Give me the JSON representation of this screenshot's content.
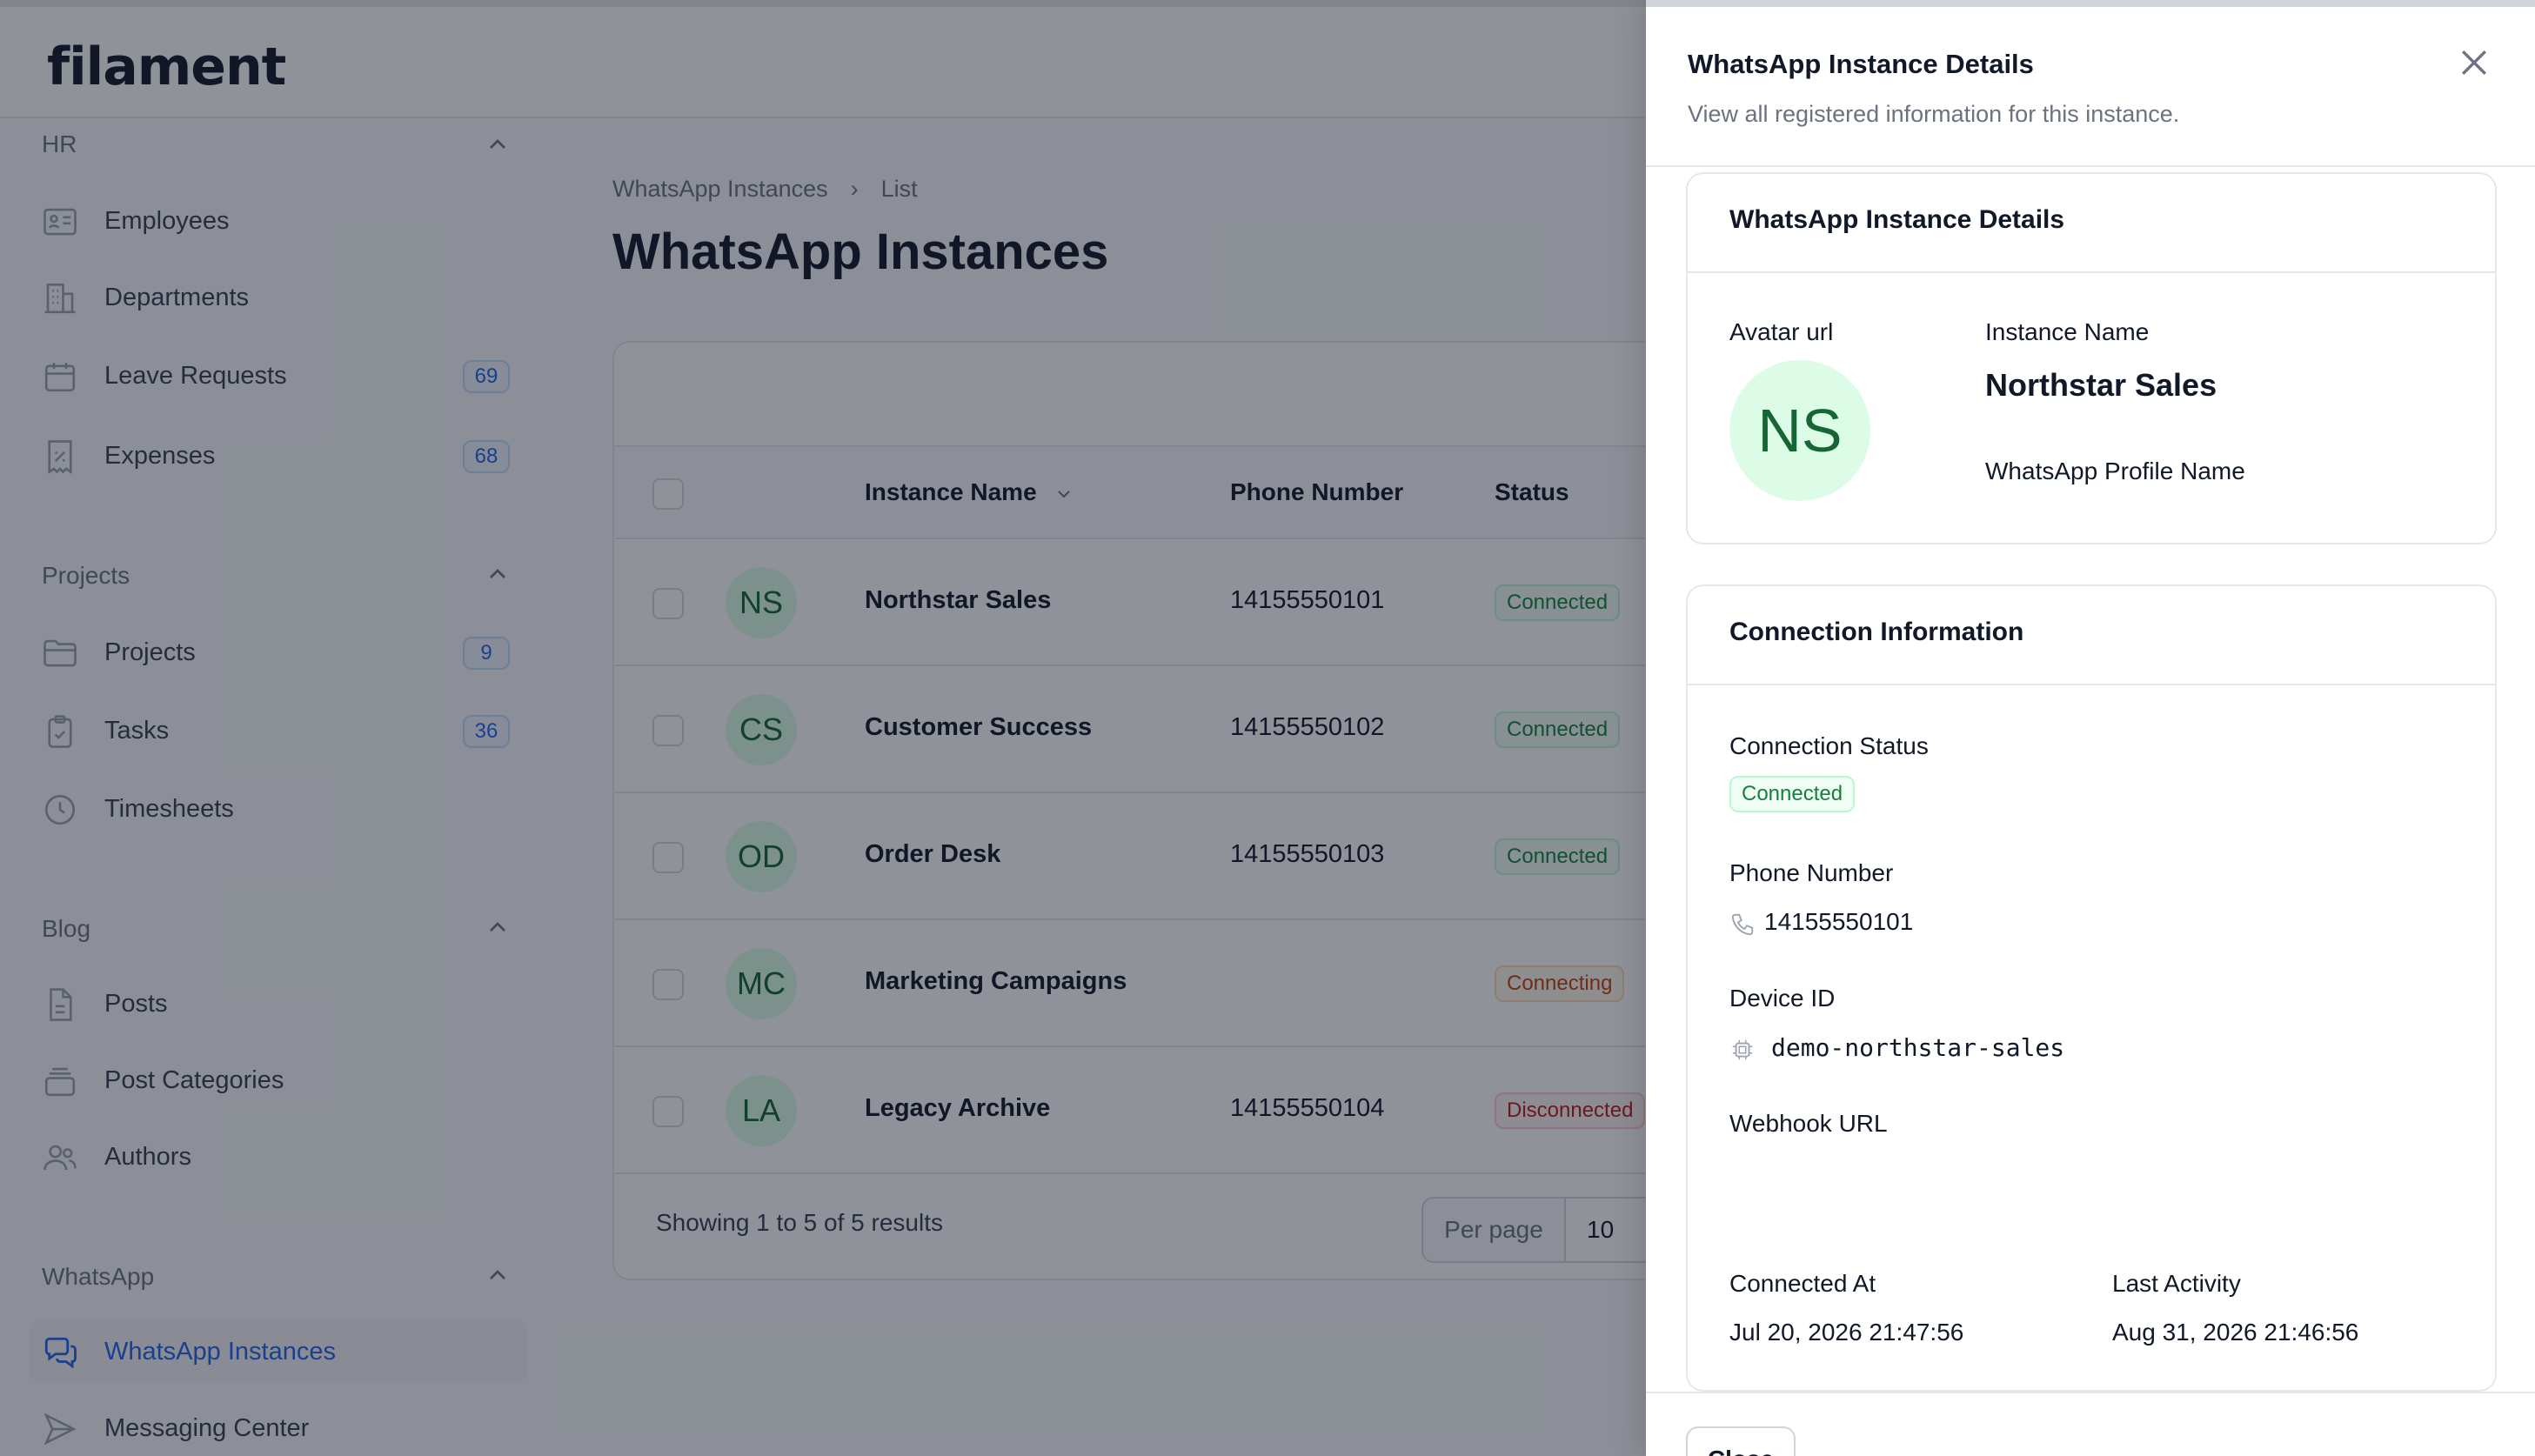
{
  "brand": {
    "logo": "filament"
  },
  "sidebar": {
    "groups": [
      {
        "title": "HR",
        "items": [
          {
            "label": "Employees",
            "icon": "id-card-icon",
            "badge": ""
          },
          {
            "label": "Departments",
            "icon": "building-icon",
            "badge": ""
          },
          {
            "label": "Leave Requests",
            "icon": "calendar-icon",
            "badge": "69"
          },
          {
            "label": "Expenses",
            "icon": "receipt-percent-icon",
            "badge": "68"
          }
        ]
      },
      {
        "title": "Projects",
        "items": [
          {
            "label": "Projects",
            "icon": "folder-icon",
            "badge": "9"
          },
          {
            "label": "Tasks",
            "icon": "clipboard-check-icon",
            "badge": "36"
          },
          {
            "label": "Timesheets",
            "icon": "clock-icon",
            "badge": ""
          }
        ]
      },
      {
        "title": "Blog",
        "items": [
          {
            "label": "Posts",
            "icon": "document-icon",
            "badge": ""
          },
          {
            "label": "Post Categories",
            "icon": "rectangle-stack-icon",
            "badge": ""
          },
          {
            "label": "Authors",
            "icon": "users-icon",
            "badge": ""
          }
        ]
      },
      {
        "title": "WhatsApp",
        "items": [
          {
            "label": "WhatsApp Instances",
            "icon": "chat-bubbles-icon",
            "badge": "",
            "active": true
          },
          {
            "label": "Messaging Center",
            "icon": "paper-airplane-icon",
            "badge": ""
          }
        ]
      }
    ]
  },
  "main": {
    "breadcrumb": [
      "WhatsApp Instances",
      "List"
    ],
    "title": "WhatsApp Instances",
    "table": {
      "columns": [
        "Instance Name",
        "Phone Number",
        "Status"
      ],
      "rows": [
        {
          "initials": "NS",
          "name": "Northstar Sales",
          "phone": "14155550101",
          "status": "Connected",
          "status_kind": "connected"
        },
        {
          "initials": "CS",
          "name": "Customer Success",
          "phone": "14155550102",
          "status": "Connected",
          "status_kind": "connected"
        },
        {
          "initials": "OD",
          "name": "Order Desk",
          "phone": "14155550103",
          "status": "Connected",
          "status_kind": "connected"
        },
        {
          "initials": "MC",
          "name": "Marketing Campaigns",
          "phone": "",
          "status": "Connecting",
          "status_kind": "connecting"
        },
        {
          "initials": "LA",
          "name": "Legacy Archive",
          "phone": "14155550104",
          "status": "Disconnected",
          "status_kind": "disconnected"
        }
      ],
      "footer": {
        "showing": "Showing 1 to 5 of 5 results",
        "per_page_label": "Per page",
        "per_page_value": "10"
      }
    }
  },
  "panel": {
    "title": "WhatsApp Instance Details",
    "subtitle": "View all registered information for this instance.",
    "details_section": {
      "title": "WhatsApp Instance Details",
      "avatar_label": "Avatar url",
      "avatar_initials": "NS",
      "instance_name_label": "Instance Name",
      "instance_name": "Northstar Sales",
      "profile_name_label": "WhatsApp Profile Name"
    },
    "connection_section": {
      "title": "Connection Information",
      "status_label": "Connection Status",
      "status": "Connected",
      "phone_label": "Phone Number",
      "phone": "14155550101",
      "device_label": "Device ID",
      "device": "demo-northstar-sales",
      "webhook_label": "Webhook URL",
      "connected_at_label": "Connected At",
      "connected_at": "Jul 20, 2026 21:47:56",
      "last_activity_label": "Last Activity",
      "last_activity": "Aug 31, 2026 21:46:56"
    },
    "close_label": "Close"
  },
  "colors": {
    "accent": "#2563eb",
    "success": "#15803d",
    "warning": "#c2410c",
    "danger": "#b91c1c"
  }
}
